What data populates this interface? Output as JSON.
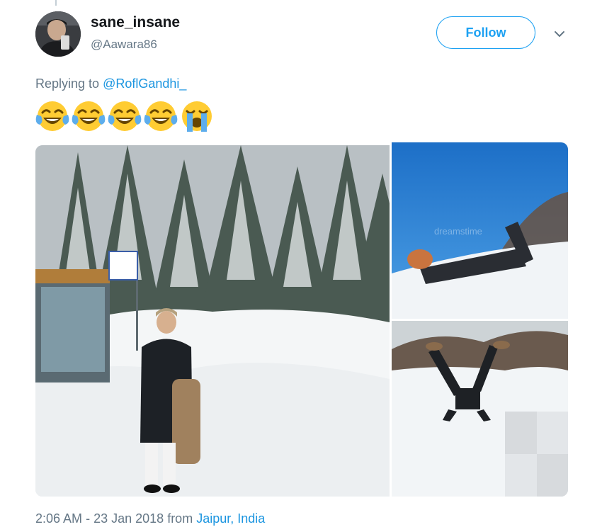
{
  "tweet": {
    "author": {
      "display_name": "sane_insane",
      "handle": "@Aawara86",
      "avatar": "avatar-photo"
    },
    "follow_label": "Follow",
    "more_icon": "chevron-down-icon",
    "reply": {
      "prefix": "Replying to",
      "mention": "@RoflGandhi_"
    },
    "emojis": [
      "face-with-tears-of-joy",
      "face-with-tears-of-joy",
      "face-with-tears-of-joy",
      "face-with-tears-of-joy",
      "loudly-crying-face"
    ],
    "media": [
      {
        "description_icon": "photo-man-in-snow-at-bus-stop",
        "watermark": ""
      },
      {
        "description_icon": "photo-person-diving-into-snow",
        "watermark": "dreamstime"
      },
      {
        "description_icon": "photo-person-headfirst-in-snow",
        "watermark": ""
      }
    ],
    "footer": {
      "time": "2:06 AM",
      "separator": "-",
      "date": "23 Jan 2018",
      "from": "from",
      "location": "Jaipur, India"
    },
    "colors": {
      "accent": "#1da1f2",
      "link": "#1b95e0",
      "secondary_text": "#657786"
    }
  }
}
